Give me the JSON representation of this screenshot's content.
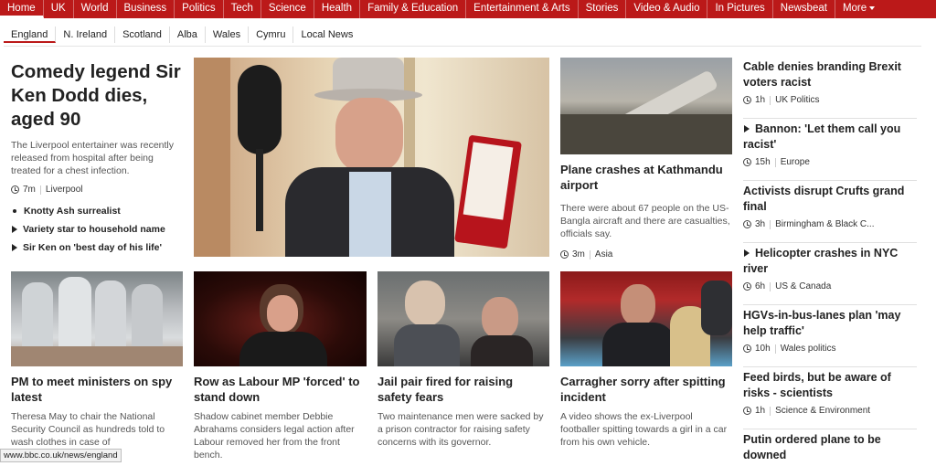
{
  "topnav": {
    "items": [
      "Home",
      "UK",
      "World",
      "Business",
      "Politics",
      "Tech",
      "Science",
      "Health",
      "Family & Education",
      "Entertainment & Arts",
      "Stories",
      "Video & Audio",
      "In Pictures",
      "Newsbeat"
    ],
    "more_label": "More",
    "active": "Home"
  },
  "subnav": {
    "items": [
      "England",
      "N. Ireland",
      "Scotland",
      "Alba",
      "Wales",
      "Cymru",
      "Local News"
    ],
    "active": "England"
  },
  "lead": {
    "headline": "Comedy legend Sir Ken Dodd dies, aged 90",
    "summary": "The Liverpool entertainer was recently released from hospital after being treated for a chest infection.",
    "time": "7m",
    "section": "Liverpool",
    "related": [
      {
        "label": "Knotty Ash surrealist",
        "icon": "bullet-icon"
      },
      {
        "label": "Variety star to household name",
        "icon": "play-icon"
      },
      {
        "label": "Sir Ken on 'best day of his life'",
        "icon": "play-icon"
      }
    ]
  },
  "crash": {
    "headline": "Plane crashes at Kathmandu airport",
    "summary": "There were about 67 people on the US-Bangla aircraft and there are casualties, officials say.",
    "time": "3m",
    "section": "Asia"
  },
  "row2": [
    {
      "headline": "PM to meet ministers on spy latest",
      "summary": "Theresa May to chair the National Security Council as hundreds told to wash clothes in case of"
    },
    {
      "headline": "Row as Labour MP 'forced' to stand down",
      "summary": "Shadow cabinet member Debbie Abrahams considers legal action after Labour removed her from the front bench."
    },
    {
      "headline": "Jail pair fired for raising safety fears",
      "summary": "Two maintenance men were sacked by a prison contractor for raising safety concerns with its governor."
    },
    {
      "headline": "Carragher sorry after spitting incident",
      "summary": "A video shows the ex-Liverpool footballer spitting towards a girl in a car from his own vehicle."
    }
  ],
  "right": [
    {
      "headline": "Cable denies branding Brexit voters racist",
      "time": "1h",
      "section": "UK Politics",
      "video": false
    },
    {
      "headline": "Bannon: 'Let them call you racist'",
      "time": "15h",
      "section": "Europe",
      "video": true
    },
    {
      "headline": "Activists disrupt Crufts grand final",
      "time": "3h",
      "section": "Birmingham & Black C...",
      "video": false
    },
    {
      "headline": "Helicopter crashes in NYC river",
      "time": "6h",
      "section": "US & Canada",
      "video": true
    },
    {
      "headline": "HGVs-in-bus-lanes plan 'may help traffic'",
      "time": "10h",
      "section": "Wales politics",
      "video": false
    },
    {
      "headline": "Feed birds, but be aware of risks - scientists",
      "time": "1h",
      "section": "Science & Environment",
      "video": false
    },
    {
      "headline": "Putin ordered plane to be downed",
      "time": "",
      "section": "",
      "video": false
    }
  ],
  "status_url": "www.bbc.co.uk/news/england",
  "colors": {
    "brand_red": "#bb1919"
  }
}
